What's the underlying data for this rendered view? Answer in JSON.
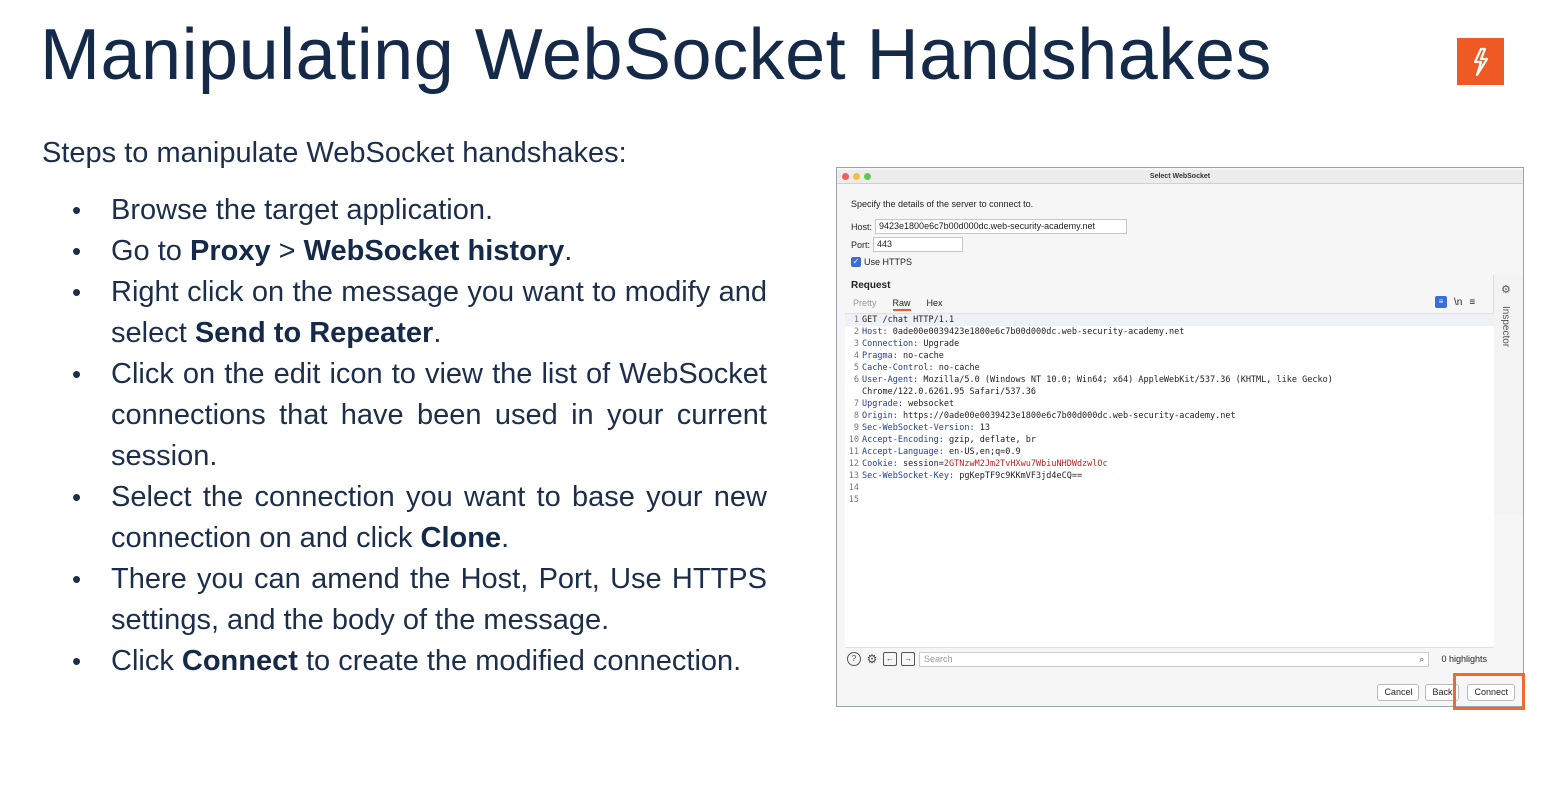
{
  "slide": {
    "title": "Manipulating WebSocket Handshakes",
    "intro": "Steps to manipulate WebSocket handshakes:",
    "steps": [
      {
        "pre": "Browse the target application."
      },
      {
        "pre": "Go to ",
        "b1": "Proxy",
        "mid": " > ",
        "b2": "WebSocket history",
        "post": "."
      },
      {
        "pre": "Right click on the message you want to modify and select ",
        "b1": "Send to Repeater",
        "post": "."
      },
      {
        "pre": "Click on the edit icon to view the list of WebSocket connections that have been used in your current session."
      },
      {
        "pre": "Select the connection you want to base your new connection on and click ",
        "b1": "Clone",
        "post": "."
      },
      {
        "pre": "There you can amend the Host, Port, Use HTTPS settings, and the body of the message."
      },
      {
        "pre": "Click ",
        "b1": "Connect",
        "post": " to create the modified connection."
      }
    ]
  },
  "colors": {
    "accent": "#ef5a24",
    "title": "#142a48",
    "highlight_box": "#ef6b2b"
  },
  "dialog": {
    "window_title": "Select WebSocket",
    "instruction": "Specify the details of the server to connect to.",
    "host_label": "Host:",
    "host_value": "9423e1800e6c7b00d000dc.web-security-academy.net",
    "port_label": "Port:",
    "port_value": "443",
    "https_label": "Use HTTPS",
    "https_checked": true,
    "request_heading": "Request",
    "tabs": [
      "Pretty",
      "Raw",
      "Hex"
    ],
    "active_tab": "Raw",
    "inspector_label": "Inspector",
    "request_lines": [
      {
        "n": "1",
        "name": "",
        "value": "GET /chat HTTP/1.1"
      },
      {
        "n": "2",
        "name": "Host:",
        "value": " 0ade00e0039423e1800e6c7b00d000dc.web-security-academy.net"
      },
      {
        "n": "3",
        "name": "Connection:",
        "value": " Upgrade"
      },
      {
        "n": "4",
        "name": "Pragma:",
        "value": " no-cache"
      },
      {
        "n": "5",
        "name": "Cache-Control:",
        "value": " no-cache"
      },
      {
        "n": "6",
        "name": "User-Agent:",
        "value": " Mozilla/5.0 (Windows NT 10.0; Win64; x64) AppleWebKit/537.36 (KHTML, like Gecko)"
      },
      {
        "n": "",
        "name": "",
        "value": "Chrome/122.0.6261.95 Safari/537.36"
      },
      {
        "n": "7",
        "name": "Upgrade:",
        "value": " websocket"
      },
      {
        "n": "8",
        "name": "Origin:",
        "value": " https://0ade00e0039423e1800e6c7b00d000dc.web-security-academy.net"
      },
      {
        "n": "9",
        "name": "Sec-WebSocket-Version:",
        "value": " 13"
      },
      {
        "n": "10",
        "name": "Accept-Encoding:",
        "value": " gzip, deflate, br"
      },
      {
        "n": "11",
        "name": "Accept-Language:",
        "value": " en-US,en;q=0.9"
      },
      {
        "n": "12",
        "name": "Cookie:",
        "value": " session=",
        "cookie": "2GTNzwM2Jm2TvHXwu7WbiuNHDWdzwlOc"
      },
      {
        "n": "13",
        "name": "Sec-WebSocket-Key:",
        "value": " pgKepTF9c9KKmVF3jd4eCQ=="
      },
      {
        "n": "14",
        "name": "",
        "value": ""
      },
      {
        "n": "15",
        "name": "",
        "value": ""
      }
    ],
    "search_placeholder": "Search",
    "highlights": "0 highlights",
    "buttons": {
      "cancel": "Cancel",
      "back": "Back",
      "connect": "Connect"
    },
    "icons": [
      "help-icon",
      "settings-icon",
      "back-arrow-icon",
      "forward-arrow-icon",
      "search-icon"
    ]
  }
}
